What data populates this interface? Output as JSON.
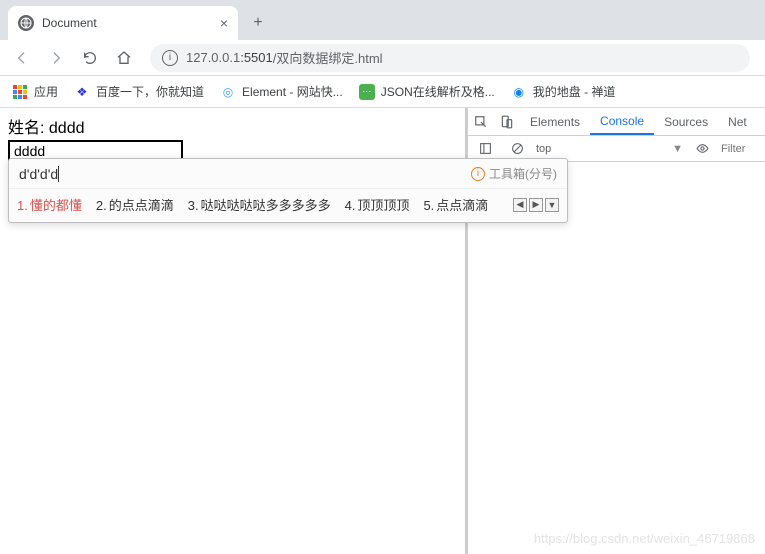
{
  "browser": {
    "tab_title": "Document",
    "url_host": "127.0.0.1",
    "url_port": ":5501",
    "url_path": "/双向数据绑定.html"
  },
  "bookmarks": {
    "apps": "应用",
    "items": [
      {
        "label": "百度一下，你就知道"
      },
      {
        "label": "Element - 网站快..."
      },
      {
        "label": "JSON在线解析及格..."
      },
      {
        "label": "我的地盘 - 禅道"
      }
    ]
  },
  "page": {
    "label_prefix": "姓名: ",
    "bound_value": "dddd",
    "input_value": "dddd"
  },
  "ime": {
    "composition": "d'd'd'd",
    "toolbox_label": "工具箱(分号)",
    "candidates": [
      {
        "n": "1.",
        "text": "懂的都懂"
      },
      {
        "n": "2.",
        "text": "的点点滴滴"
      },
      {
        "n": "3.",
        "text": "哒哒哒哒哒多多多多多"
      },
      {
        "n": "4.",
        "text": "顶顶顶顶"
      },
      {
        "n": "5.",
        "text": "点点滴滴"
      }
    ]
  },
  "devtools": {
    "tabs": {
      "elements": "Elements",
      "console": "Console",
      "sources": "Sources",
      "network": "Net"
    },
    "context": "top",
    "filter_placeholder": "Filter"
  },
  "watermark": "https://blog.csdn.net/weixin_46719868"
}
